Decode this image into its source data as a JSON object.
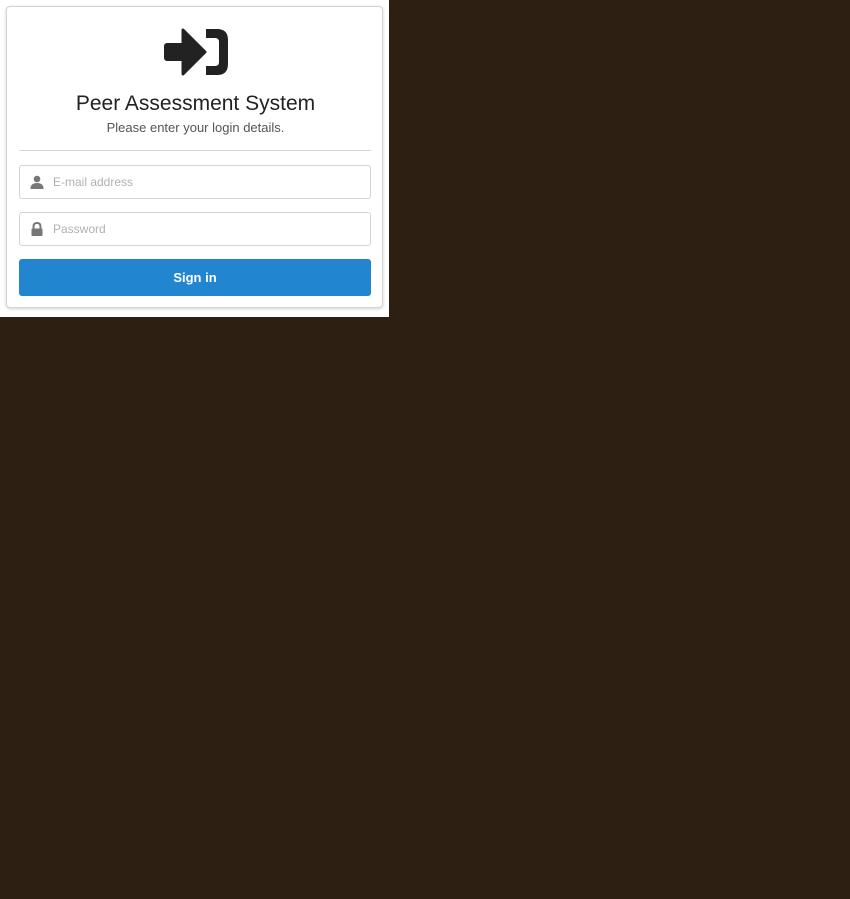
{
  "login": {
    "logo_icon": "sign-in-icon",
    "title": "Peer Assessment System",
    "subtitle": "Please enter your login details.",
    "email": {
      "icon": "user-icon",
      "placeholder": "E-mail address",
      "value": ""
    },
    "password": {
      "icon": "lock-icon",
      "placeholder": "Password",
      "value": ""
    },
    "submit_label": "Sign in"
  },
  "colors": {
    "background": "#2d1f11",
    "primary_button": "#2185d0",
    "card": "#ffffff"
  }
}
